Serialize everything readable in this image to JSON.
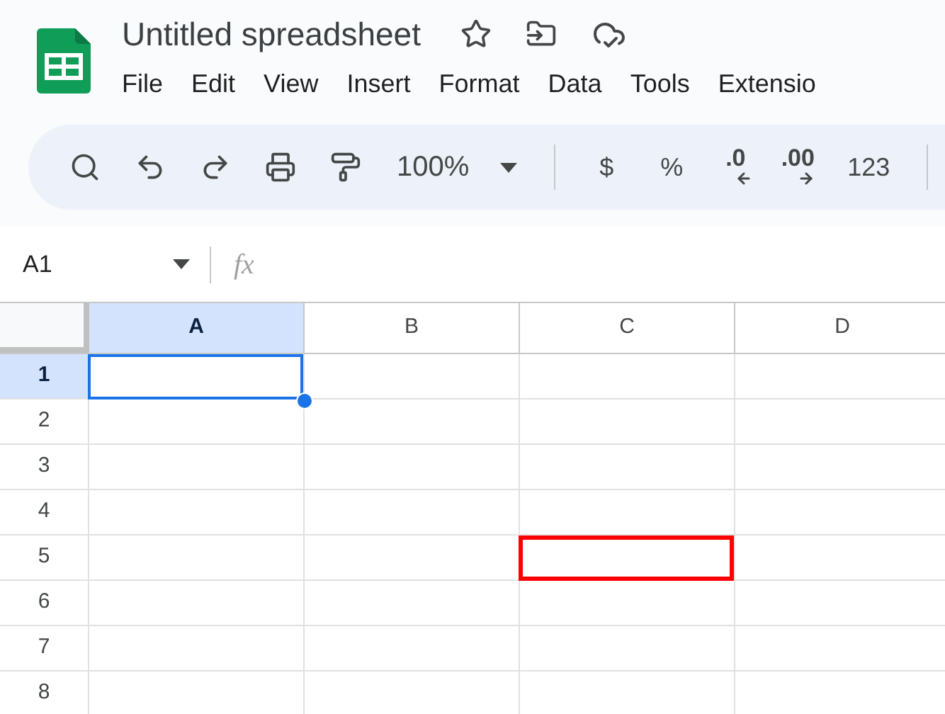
{
  "document": {
    "title": "Untitled spreadsheet"
  },
  "menu": [
    {
      "label": "File"
    },
    {
      "label": "Edit"
    },
    {
      "label": "View"
    },
    {
      "label": "Insert"
    },
    {
      "label": "Format"
    },
    {
      "label": "Data"
    },
    {
      "label": "Tools"
    },
    {
      "label": "Extensio"
    }
  ],
  "toolbar": [
    {
      "kind": "search"
    },
    {
      "kind": "undo"
    },
    {
      "kind": "redo"
    },
    {
      "kind": "print"
    },
    {
      "kind": "paint"
    },
    {
      "kind": "zoom",
      "label": "100%"
    },
    {
      "kind": "divider"
    },
    {
      "kind": "text",
      "label": "$"
    },
    {
      "kind": "text",
      "label": "%"
    },
    {
      "kind": "decrease",
      "label": ".0"
    },
    {
      "kind": "increase",
      "label": ".00"
    },
    {
      "kind": "text",
      "label": "123"
    },
    {
      "kind": "divider"
    }
  ],
  "formula_bar": {
    "cell_reference": "A1",
    "fx": "fx"
  },
  "columns": [
    {
      "label": "A",
      "selected": true
    },
    {
      "label": "B",
      "selected": false
    },
    {
      "label": "C",
      "selected": false
    },
    {
      "label": "D",
      "selected": false
    }
  ],
  "rows": [
    {
      "label": "1",
      "selected": true,
      "cells": [
        {
          "selected": true,
          "highlighted": false
        },
        {
          "selected": false,
          "highlighted": false
        },
        {
          "selected": false,
          "highlighted": false
        },
        {
          "selected": false,
          "highlighted": false
        }
      ]
    },
    {
      "label": "2",
      "selected": false,
      "cells": [
        {
          "selected": false,
          "highlighted": false
        },
        {
          "selected": false,
          "highlighted": false
        },
        {
          "selected": false,
          "highlighted": false
        },
        {
          "selected": false,
          "highlighted": false
        }
      ]
    },
    {
      "label": "3",
      "selected": false,
      "cells": [
        {
          "selected": false,
          "highlighted": false
        },
        {
          "selected": false,
          "highlighted": false
        },
        {
          "selected": false,
          "highlighted": false
        },
        {
          "selected": false,
          "highlighted": false
        }
      ]
    },
    {
      "label": "4",
      "selected": false,
      "cells": [
        {
          "selected": false,
          "highlighted": false
        },
        {
          "selected": false,
          "highlighted": false
        },
        {
          "selected": false,
          "highlighted": false
        },
        {
          "selected": false,
          "highlighted": false
        }
      ]
    },
    {
      "label": "5",
      "selected": false,
      "cells": [
        {
          "selected": false,
          "highlighted": false
        },
        {
          "selected": false,
          "highlighted": false
        },
        {
          "selected": false,
          "highlighted": true
        },
        {
          "selected": false,
          "highlighted": false
        }
      ]
    },
    {
      "label": "6",
      "selected": false,
      "cells": [
        {
          "selected": false,
          "highlighted": false
        },
        {
          "selected": false,
          "highlighted": false
        },
        {
          "selected": false,
          "highlighted": false
        },
        {
          "selected": false,
          "highlighted": false
        }
      ]
    },
    {
      "label": "7",
      "selected": false,
      "cells": [
        {
          "selected": false,
          "highlighted": false
        },
        {
          "selected": false,
          "highlighted": false
        },
        {
          "selected": false,
          "highlighted": false
        },
        {
          "selected": false,
          "highlighted": false
        }
      ]
    },
    {
      "label": "8",
      "selected": false,
      "cells": [
        {
          "selected": false,
          "highlighted": false
        },
        {
          "selected": false,
          "highlighted": false
        },
        {
          "selected": false,
          "highlighted": false
        },
        {
          "selected": false,
          "highlighted": false
        }
      ]
    }
  ]
}
